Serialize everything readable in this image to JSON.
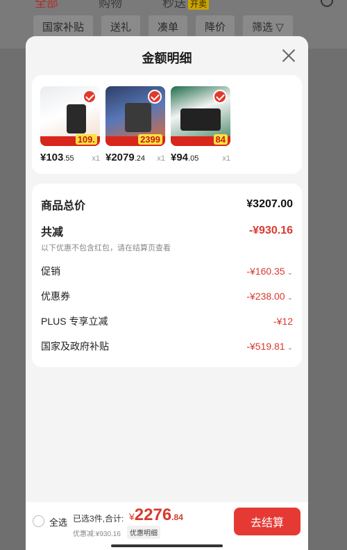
{
  "background": {
    "tabs": [
      {
        "label": "全部",
        "active": true
      },
      {
        "label": "购物",
        "active": false
      },
      {
        "label": "秒送",
        "active": false,
        "badge": "开卖"
      }
    ],
    "filter_chips": [
      "国家补贴",
      "送礼",
      "凑单",
      "降价",
      "筛选 ▽"
    ]
  },
  "sheet": {
    "title": "金额明细"
  },
  "products": [
    {
      "price_int": "¥103",
      "price_dec": ".55",
      "qty": "x1",
      "promo": "109."
    },
    {
      "price_int": "¥2079",
      "price_dec": ".24",
      "qty": "x1",
      "promo": "2399"
    },
    {
      "price_int": "¥94",
      "price_dec": ".05",
      "qty": "x1",
      "promo": "84"
    }
  ],
  "summary": {
    "total_label": "商品总价",
    "total_value": "¥3207.00",
    "reduce_label": "共减",
    "reduce_value": "-¥930.16",
    "note": "以下优惠不包含红包，请在结算页查看",
    "items": [
      {
        "label": "促销",
        "value": "-¥160.35"
      },
      {
        "label": "优惠券",
        "value": "-¥238.00"
      },
      {
        "label": "PLUS 专享立减",
        "value": "-¥12"
      },
      {
        "label": "国家及政府补贴",
        "value": "-¥519.81"
      }
    ]
  },
  "footer": {
    "select_all": "全选",
    "selected_info": "已选3件,合计:",
    "total_yen": "¥",
    "total_int": "2276",
    "total_dec": ".84",
    "discount": "优惠减:¥930.16",
    "detail_tag": "优惠明细",
    "checkout": "去结算"
  },
  "colors": {
    "accent": "#e53a33",
    "discount_red": "#d83a2e"
  }
}
